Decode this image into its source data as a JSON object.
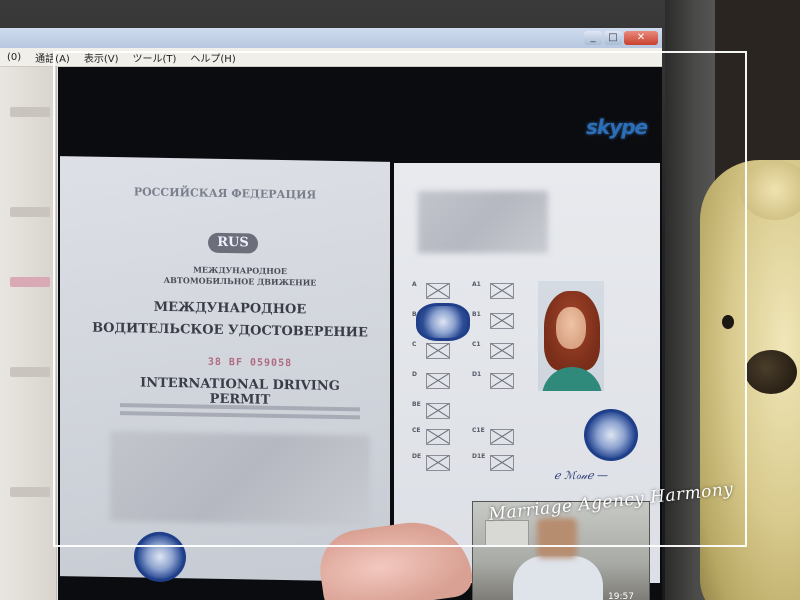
{
  "window": {
    "controls": {
      "minimize": "_",
      "maximize": "□",
      "close": "✕"
    }
  },
  "menubar": {
    "items": [
      {
        "label": "(0)"
      },
      {
        "label": "通話(A)"
      },
      {
        "label": "表示(V)"
      },
      {
        "label": "ツール(T)"
      },
      {
        "label": "ヘルプ(H)"
      }
    ]
  },
  "video": {
    "app_logo": "skype"
  },
  "permit": {
    "country": "РОССИЙСКАЯ ФЕДЕРАЦИЯ",
    "country_code": "RUS",
    "small_line_1": "МЕЖДУНАРОДНОЕ",
    "small_line_2": "АВТОМОБИЛЬНОЕ ДВИЖЕНИЕ",
    "title_ru_1": "МЕЖДУНАРОДНОЕ",
    "title_ru_2": "ВОДИТЕЛЬСКОЕ УДОСТОВЕРЕНИЕ",
    "number": "38 BF 059058",
    "title_en": "INTERNATIONAL DRIVING PERMIT"
  },
  "categories": {
    "left": [
      "A",
      "B",
      "C",
      "D",
      "BE",
      "CE",
      "DE"
    ],
    "right": [
      "A1",
      "B1",
      "C1",
      "D1",
      "C1E",
      "D1E"
    ]
  },
  "clock": "19:57",
  "watermark": "Marriage Agency Harmony",
  "colors": {
    "skype_blue": "#2a6fb8",
    "stamp_blue": "#1f3f8a",
    "titlebar_close": "#c8412f"
  }
}
